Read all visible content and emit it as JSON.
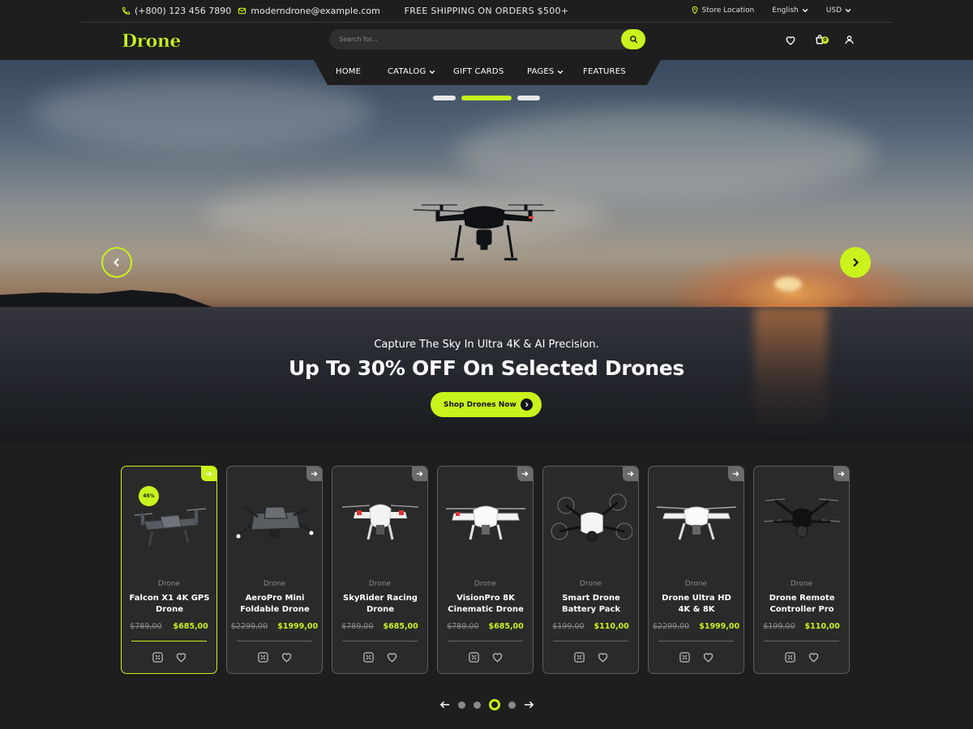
{
  "topbar": {
    "phone": "(+800) 123 456 7890",
    "email": "moderndrone@example.com",
    "promo": "FREE SHIPPING ON ORDERS $500+",
    "store_location": "Store Location",
    "language": "English",
    "currency": "USD"
  },
  "header": {
    "logo": "Drone",
    "search_placeholder": "Search for...",
    "cart_count": "0"
  },
  "nav": {
    "home": "HOME",
    "catalog": "CATALOG",
    "gift_cards": "GIFT CARDS",
    "pages": "PAGES",
    "features": "FEATURES"
  },
  "hero": {
    "subtitle": "Capture The Sky In Ultra 4K & AI Precision.",
    "title": "Up To 30% OFF On Selected Drones",
    "cta": "Shop Drones Now",
    "active_slide": 2,
    "slide_count": 3
  },
  "colors": {
    "accent": "#c8f31d",
    "background": "#1e1e1e",
    "card": "#2a2a2a"
  },
  "products": [
    {
      "brand": "Drone",
      "name": "Falcon X1 4K GPS Drone",
      "old_price": "$789,00",
      "price": "$685,00",
      "discount": "45%",
      "active": true
    },
    {
      "brand": "Drone",
      "name": "AeroPro Mini Foldable Drone",
      "old_price": "$2299,00",
      "price": "$1999,00"
    },
    {
      "brand": "Drone",
      "name": "SkyRider Racing Drone",
      "old_price": "$789,00",
      "price": "$685,00"
    },
    {
      "brand": "Drone",
      "name": "VisionPro 8K Cinematic Drone",
      "old_price": "$789,00",
      "price": "$685,00"
    },
    {
      "brand": "Drone",
      "name": "Smart Drone Battery Pack",
      "old_price": "$199,00",
      "price": "$110,00"
    },
    {
      "brand": "Drone",
      "name": "Drone Ultra HD 4K & 8K",
      "old_price": "$2299,00",
      "price": "$1999,00"
    },
    {
      "brand": "Drone",
      "name": "Drone Remote Controller Pro",
      "old_price": "$199,00",
      "price": "$110,00"
    }
  ],
  "pager": {
    "pages": 4,
    "active": 3
  }
}
